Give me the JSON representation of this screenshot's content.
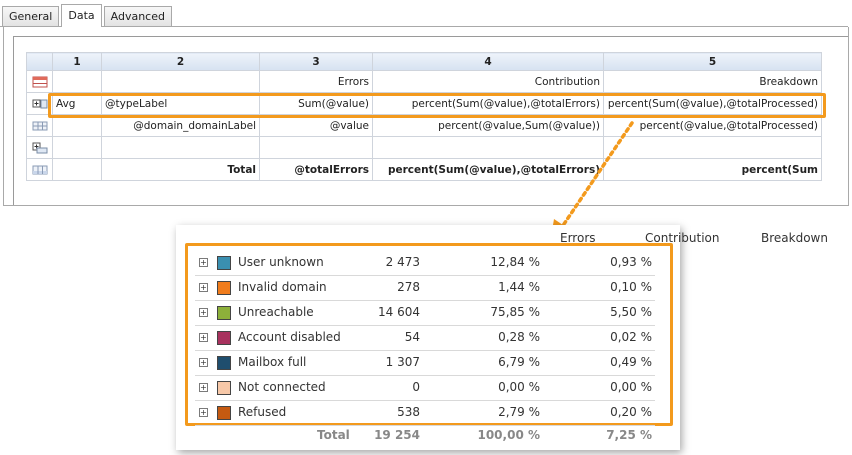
{
  "tabs": [
    {
      "label": "General",
      "active": false
    },
    {
      "label": "Data",
      "active": true
    },
    {
      "label": "Advanced",
      "active": false
    }
  ],
  "grid": {
    "columns": [
      "",
      "1",
      "2",
      "3",
      "4",
      "5"
    ],
    "rows": [
      {
        "icon": "column-header-icon",
        "cells": [
          "",
          "",
          "Errors",
          "Contribution",
          "Breakdown"
        ]
      },
      {
        "icon": "expand-group-icon",
        "cells": [
          "Avg",
          "@typeLabel",
          "Sum(@value)",
          "percent(Sum(@value),@totalErrors)",
          "percent(Sum(@value),@totalProcessed)"
        ]
      },
      {
        "icon": "detail-row-icon",
        "cells": [
          "",
          "@domain_domainLabel",
          "@value",
          "percent(@value,Sum(@value))",
          "percent(@value,@totalProcessed)"
        ]
      },
      {
        "icon": "add-row-icon",
        "cells": [
          "",
          "",
          "",
          "",
          ""
        ]
      },
      {
        "icon": "total-row-icon",
        "cells": [
          "",
          "Total",
          "@totalErrors",
          "percent(Sum(@value),@totalErrors)",
          "percent(Sum"
        ]
      }
    ]
  },
  "preview": {
    "headers": [
      "Errors",
      "Contribution",
      "Breakdown"
    ],
    "rows": [
      {
        "label": "User unknown",
        "errors": "2 473",
        "contribution": "12,84 %",
        "breakdown": "0,93 %",
        "color": "#3a8fb0"
      },
      {
        "label": "Invalid domain",
        "errors": "278",
        "contribution": "1,44 %",
        "breakdown": "0,10 %",
        "color": "#f07c1c"
      },
      {
        "label": "Unreachable",
        "errors": "14 604",
        "contribution": "75,85 %",
        "breakdown": "5,50 %",
        "color": "#8db03a"
      },
      {
        "label": "Account disabled",
        "errors": "54",
        "contribution": "0,28 %",
        "breakdown": "0,02 %",
        "color": "#a8325e"
      },
      {
        "label": "Mailbox full",
        "errors": "1 307",
        "contribution": "6,79 %",
        "breakdown": "0,49 %",
        "color": "#1f4e6e"
      },
      {
        "label": "Not connected",
        "errors": "0",
        "contribution": "0,00 %",
        "breakdown": "0,00 %",
        "color": "#f7c8a8"
      },
      {
        "label": "Refused",
        "errors": "538",
        "contribution": "2,79 %",
        "breakdown": "0,20 %",
        "color": "#c55a11"
      }
    ],
    "total": {
      "label": "Total",
      "errors": "19 254",
      "contribution": "100,00 %",
      "breakdown": "7,25 %"
    }
  },
  "colors": {
    "highlight": "#f39a1d",
    "header_bg": "#d6e2f1",
    "grid_border": "#cfd4dc"
  }
}
